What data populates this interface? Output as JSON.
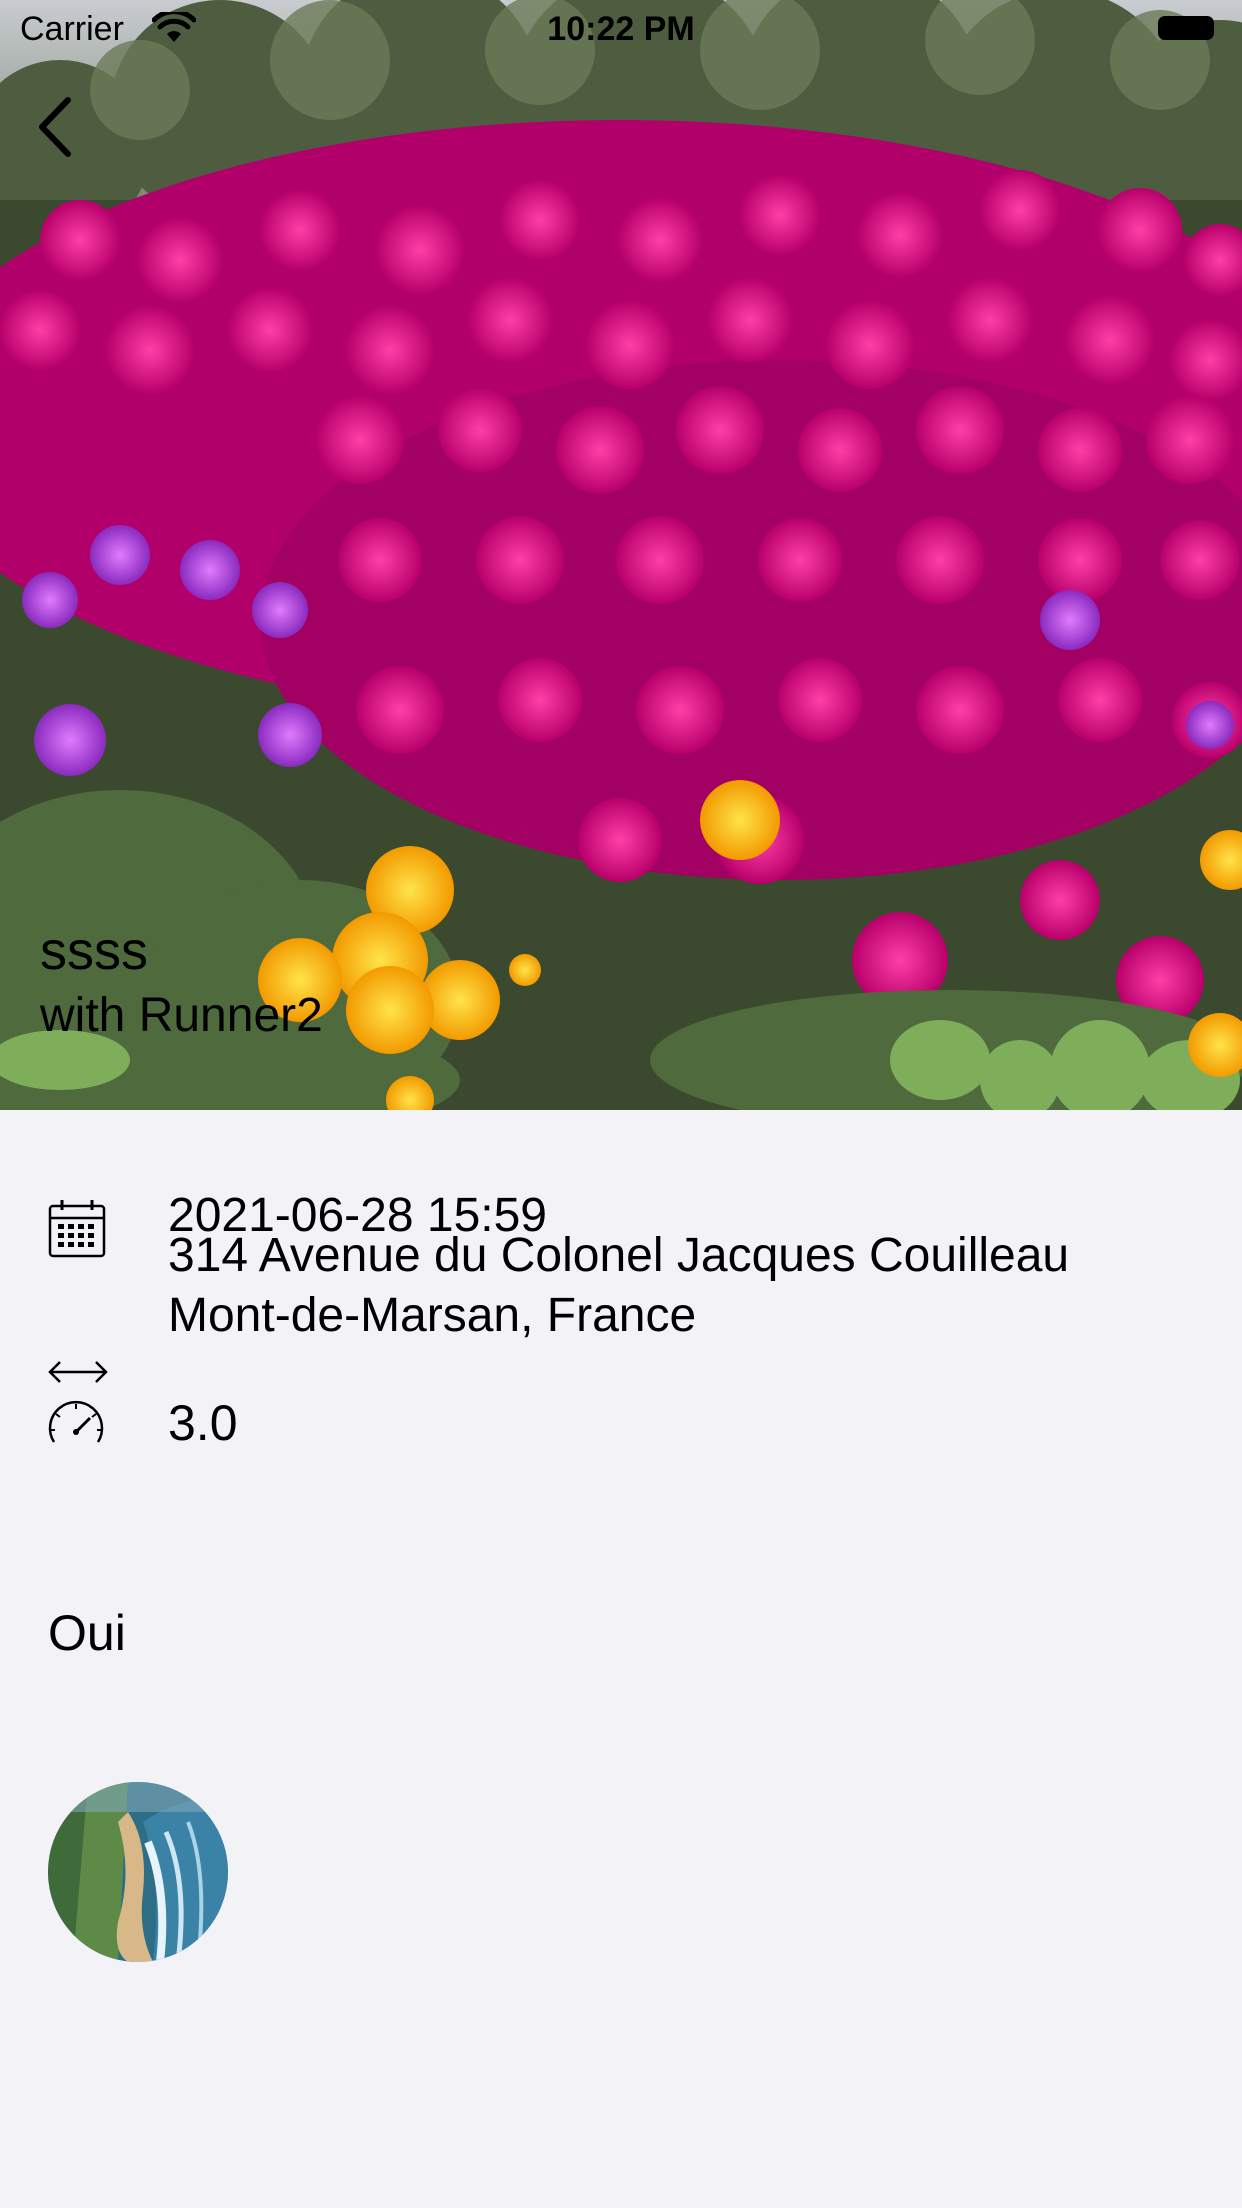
{
  "status_bar": {
    "carrier": "Carrier",
    "time": "10:22 PM"
  },
  "header": {
    "back_icon": "chevron-left-icon",
    "title": "ssss",
    "subtitle": "with Runner2"
  },
  "details": {
    "date_icon": "calendar-icon",
    "date": "2021-06-28 15:59",
    "address_line1": "314 Avenue du Colonel Jacques Couilleau",
    "address_line2": "Mont-de-Marsan, France",
    "distance_icon": "horizontal-arrows-icon",
    "speed_icon": "speedometer-icon",
    "speed": "3.0",
    "answer": "Oui"
  },
  "participant": {
    "avatar_icon": "beach-photo-avatar"
  }
}
